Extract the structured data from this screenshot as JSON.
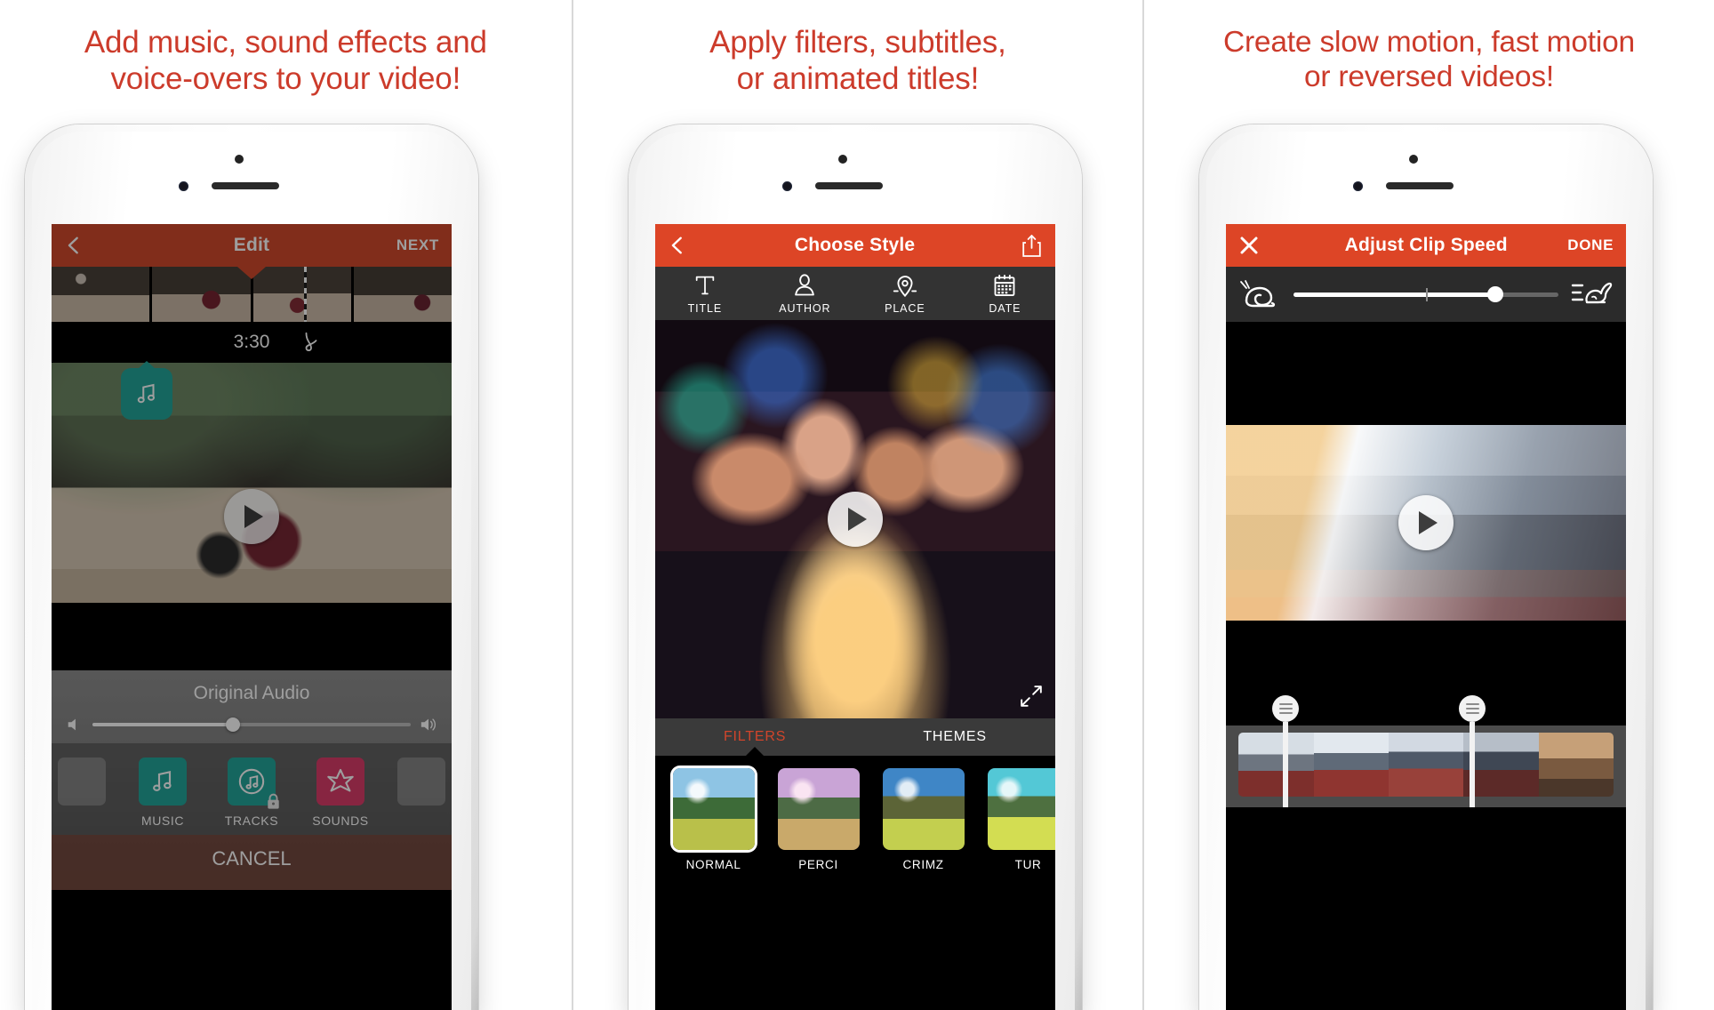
{
  "theme": {
    "headline_red": "#cc3b2b",
    "navbar_red": "#dd4526",
    "teal": "#17a89b",
    "pink": "#e8376a",
    "filter_accent": "#d1452b"
  },
  "panels": [
    {
      "headline": "Add music, sound effects and\nvoice-overs to your video!",
      "navbar": {
        "back_icon": "chevron-left-icon",
        "title": "Edit",
        "action_label": "NEXT"
      },
      "timeline": {
        "duration_label": "3:30",
        "source_icon": "vine-icon"
      },
      "audio": {
        "title": "Original Audio",
        "volume_percent": 44,
        "mute_icon": "speaker-low-icon",
        "max_icon": "speaker-high-icon"
      },
      "tools": [
        {
          "label": "MUSIC",
          "icon": "music-note-icon",
          "color": "#17a89b",
          "locked": false
        },
        {
          "label": "TRACKS",
          "icon": "music-circle-icon",
          "color": "#17a89b",
          "locked": true
        },
        {
          "label": "SOUNDS",
          "icon": "star-burst-icon",
          "color": "#e8376a",
          "locked": false
        }
      ],
      "cancel_label": "CANCEL"
    },
    {
      "headline": "Apply filters, subtitles,\nor animated titles!",
      "navbar": {
        "back_icon": "chevron-left-icon",
        "title": "Choose Style",
        "action_icon": "share-icon"
      },
      "style_tabs": [
        {
          "label": "TITLE",
          "icon": "text-t-icon"
        },
        {
          "label": "AUTHOR",
          "icon": "person-icon"
        },
        {
          "label": "PLACE",
          "icon": "map-pin-icon"
        },
        {
          "label": "DATE",
          "icon": "calendar-icon"
        }
      ],
      "expand_icon": "expand-arrows-icon",
      "filter_tabs": [
        {
          "label": "FILTERS",
          "active": true
        },
        {
          "label": "THEMES",
          "active": false
        }
      ],
      "filters": [
        {
          "name": "NORMAL",
          "selected": true
        },
        {
          "name": "PERCI",
          "selected": false
        },
        {
          "name": "CRIMZ",
          "selected": false
        },
        {
          "name": "TUR",
          "selected": false
        }
      ]
    },
    {
      "headline": "Create slow motion, fast motion\nor reversed videos!",
      "navbar": {
        "close_icon": "close-x-icon",
        "title": "Adjust Clip Speed",
        "action_label": "DONE"
      },
      "speed": {
        "slow_icon": "snail-icon",
        "fast_icon": "rabbit-icon",
        "value_percent": 76,
        "center_tick_percent": 50
      },
      "trim": {
        "left_handle_percent": 8,
        "right_handle_percent": 58,
        "handle_icon": "grip-lines-icon"
      }
    }
  ]
}
